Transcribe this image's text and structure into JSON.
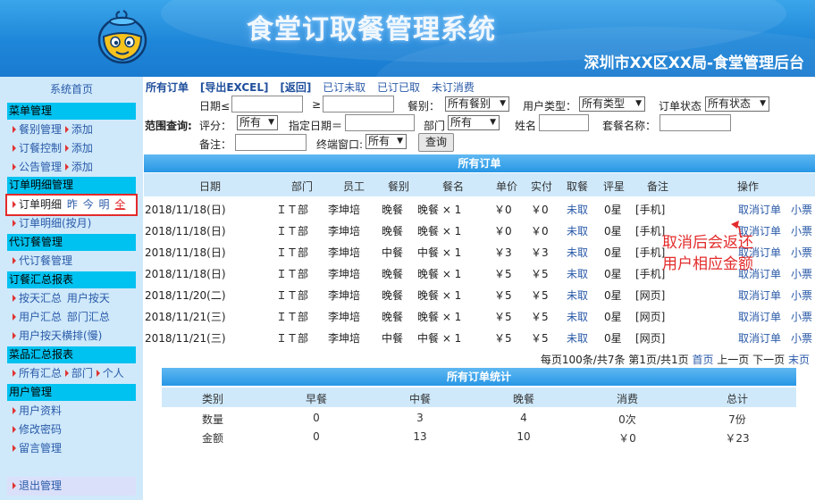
{
  "header": {
    "title": "食堂订取餐管理系统",
    "subtitle": "深圳市XX区XX局-食堂管理后台"
  },
  "sidebar": {
    "home": "系统首页",
    "sections": [
      {
        "title": "菜单管理",
        "items": [
          {
            "label": "餐别管理",
            "extra": "添加"
          },
          {
            "label": "订餐控制",
            "extra": "添加"
          },
          {
            "label": "公告管理",
            "extra": "添加"
          }
        ]
      },
      {
        "title": "订单明细管理",
        "items": [
          {
            "label": "订单明细",
            "sub1": "昨",
            "sub2": "今",
            "sub3": "明",
            "sub4": "全"
          },
          {
            "label": "订单明细(按月)"
          }
        ]
      },
      {
        "title": "代订餐管理",
        "items": [
          {
            "label": "代订餐管理"
          }
        ]
      },
      {
        "title": "订餐汇总报表",
        "items": [
          {
            "label": "按天汇总",
            "sub1": "用户按天"
          },
          {
            "label": "用户汇总",
            "sub1": "部门汇总"
          },
          {
            "label": "用户按天横排(慢)"
          }
        ]
      },
      {
        "title": "菜品汇总报表",
        "items": [
          {
            "label": "所有汇总",
            "sub1": "部门",
            "sub2": "个人"
          }
        ]
      },
      {
        "title": "用户管理",
        "items": [
          {
            "label": "用户资料"
          },
          {
            "label": "修改密码"
          },
          {
            "label": "留言管理"
          }
        ]
      }
    ],
    "logout": "退出管理"
  },
  "toplinks": {
    "all_orders": "所有订单",
    "export": "[导出EXCEL]",
    "back": "[返回]",
    "ordered_not_taken": "已订未取",
    "ordered_taken": "已订已取",
    "not_consumed": "未订消费"
  },
  "filters": {
    "date_label": "日期≤",
    "ge_label": "≥",
    "meal_label": "餐别：",
    "meal_value": "所有餐别",
    "usertype_label": "用户类型：",
    "usertype_value": "所有类型",
    "status_label": "订单状态",
    "status_value": "所有状态",
    "range_label": "范围查询:",
    "rating_label": "评分：",
    "rating_value": "所有",
    "fixdate_label": "指定日期＝",
    "dept_label": "部门",
    "dept_value": "所有",
    "name_label": "姓名",
    "package_label": "套餐名称：",
    "remark_label": "备注：",
    "terminal_label": "终端窗口:",
    "terminal_value": "所有",
    "query_button": "查询"
  },
  "orders": {
    "title": "所有订单",
    "columns": [
      "日期",
      "部门",
      "员工",
      "餐别",
      "餐名",
      "单价",
      "实付",
      "取餐",
      "评星",
      "备注",
      "操作"
    ],
    "rows": [
      {
        "date": "2018/11/18(日)",
        "dept": "ＩＴ部",
        "staff": "李坤培",
        "meal": "晚餐",
        "dish": "晚餐 × 1",
        "price": "￥0",
        "paid": "￥0",
        "take": "未取",
        "rating": "0星",
        "remark": "[手机]",
        "cancel": "取消订单",
        "ticket": "小票"
      },
      {
        "date": "2018/11/18(日)",
        "dept": "ＩＴ部",
        "staff": "李坤培",
        "meal": "晚餐",
        "dish": "晚餐 × 1",
        "price": "￥0",
        "paid": "￥0",
        "take": "未取",
        "rating": "0星",
        "remark": "[手机]",
        "cancel": "取消订单",
        "ticket": "小票"
      },
      {
        "date": "2018/11/18(日)",
        "dept": "ＩＴ部",
        "staff": "李坤培",
        "meal": "中餐",
        "dish": "中餐 × 1",
        "price": "￥3",
        "paid": "￥3",
        "take": "未取",
        "rating": "0星",
        "remark": "[手机]",
        "cancel": "取消订单",
        "ticket": "小票"
      },
      {
        "date": "2018/11/18(日)",
        "dept": "ＩＴ部",
        "staff": "李坤培",
        "meal": "晚餐",
        "dish": "晚餐 × 1",
        "price": "￥5",
        "paid": "￥5",
        "take": "未取",
        "rating": "0星",
        "remark": "[手机]",
        "cancel": "取消订单",
        "ticket": "小票"
      },
      {
        "date": "2018/11/20(二)",
        "dept": "ＩＴ部",
        "staff": "李坤培",
        "meal": "晚餐",
        "dish": "晚餐 × 1",
        "price": "￥5",
        "paid": "￥5",
        "take": "未取",
        "rating": "0星",
        "remark": "[网页]",
        "cancel": "取消订单",
        "ticket": "小票"
      },
      {
        "date": "2018/11/21(三)",
        "dept": "ＩＴ部",
        "staff": "李坤培",
        "meal": "晚餐",
        "dish": "晚餐 × 1",
        "price": "￥5",
        "paid": "￥5",
        "take": "未取",
        "rating": "0星",
        "remark": "[网页]",
        "cancel": "取消订单",
        "ticket": "小票"
      },
      {
        "date": "2018/11/21(三)",
        "dept": "ＩＴ部",
        "staff": "李坤培",
        "meal": "中餐",
        "dish": "中餐 × 1",
        "price": "￥5",
        "paid": "￥5",
        "take": "未取",
        "rating": "0星",
        "remark": "[网页]",
        "cancel": "取消订单",
        "ticket": "小票"
      }
    ],
    "pager_text": "每页100条/共7条 第1页/共1页",
    "first": "首页",
    "prev": "上一页",
    "next": "下一页",
    "last": "末页"
  },
  "annotation": "取消后会返还用户相应金额",
  "stats": {
    "title": "所有订单统计",
    "columns": [
      "类别",
      "早餐",
      "中餐",
      "晚餐",
      "消费",
      "总计"
    ],
    "rows": [
      [
        "数量",
        "0",
        "3",
        "4",
        "0次",
        "7份"
      ],
      [
        "金额",
        "0",
        "13",
        "10",
        "￥0",
        "￥23"
      ]
    ]
  },
  "colors": {
    "accent": "#1e86d8",
    "section": "#00c2f0",
    "sidebar_bg": "#cfe9fb",
    "highlight": "#e32b2b"
  }
}
